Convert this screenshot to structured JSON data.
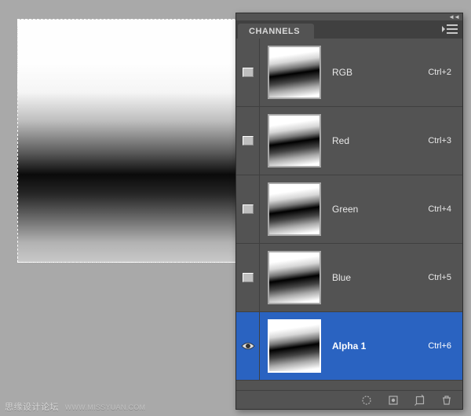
{
  "panel": {
    "tab_label": "CHANNELS",
    "channels": [
      {
        "name": "RGB",
        "shortcut": "Ctrl+2",
        "visible_eye": false,
        "selected": false
      },
      {
        "name": "Red",
        "shortcut": "Ctrl+3",
        "visible_eye": false,
        "selected": false
      },
      {
        "name": "Green",
        "shortcut": "Ctrl+4",
        "visible_eye": false,
        "selected": false
      },
      {
        "name": "Blue",
        "shortcut": "Ctrl+5",
        "visible_eye": false,
        "selected": false
      },
      {
        "name": "Alpha 1",
        "shortcut": "Ctrl+6",
        "visible_eye": true,
        "selected": true
      }
    ],
    "footer_icons": [
      "load-selection-icon",
      "save-selection-icon",
      "new-channel-icon",
      "delete-channel-icon"
    ]
  },
  "watermark": {
    "text": "思缘设计论坛",
    "url": "WWW.MISSYUAN.COM"
  }
}
